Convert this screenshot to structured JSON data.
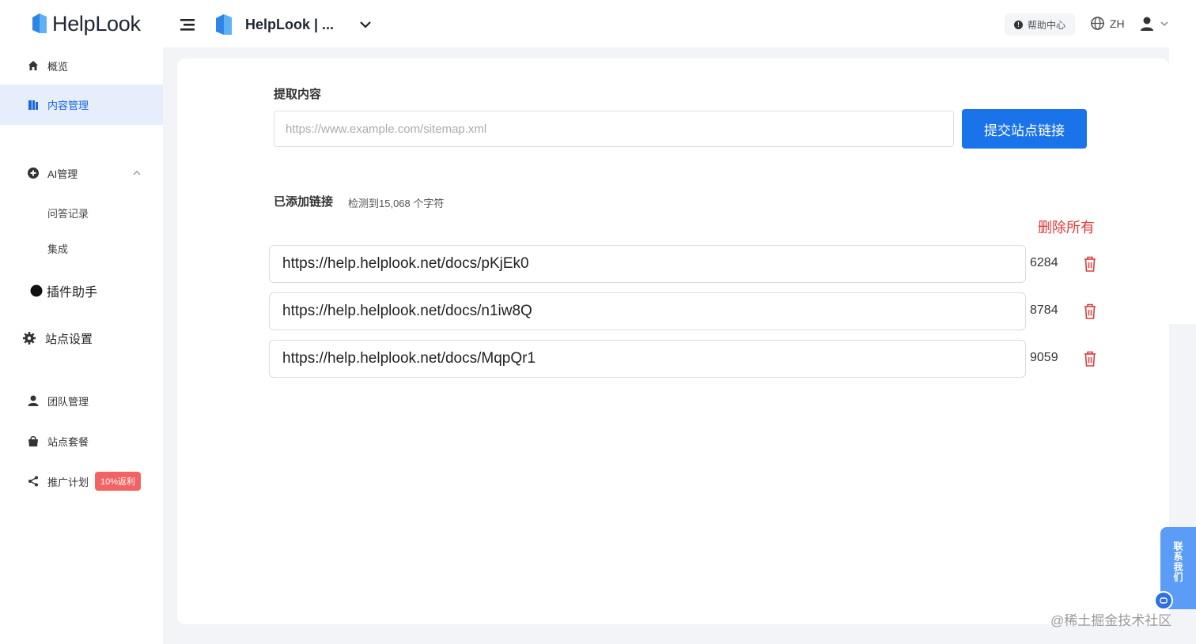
{
  "header": {
    "brand": "HelpLook",
    "site_name": "HelpLook | ...",
    "help_center": "帮助中心",
    "language": "ZH"
  },
  "sidebar": {
    "overview": "概览",
    "content_management": "内容管理",
    "ai_management": "AI管理",
    "qa_records": "问答记录",
    "integration": "集成",
    "plugin_assistant": "插件助手",
    "site_settings": "站点设置",
    "team_management": "团队管理",
    "site_plans": "站点套餐",
    "referral": "推广计划",
    "referral_badge": "10%返利"
  },
  "main": {
    "extract_title": "提取内容",
    "url_placeholder": "https://www.example.com/sitemap.xml",
    "submit_label": "提交站点链接",
    "added_title": "已添加链接",
    "detected_text": "检测到15,068 个字符",
    "delete_all": "删除所有",
    "links": [
      {
        "url": "https://help.helplook.net/docs/pKjEk0",
        "count": "6284"
      },
      {
        "url": "https://help.helplook.net/docs/n1iw8Q",
        "count": "8784"
      },
      {
        "url": "https://help.helplook.net/docs/MqpQr1",
        "count": "9059"
      }
    ]
  },
  "contact_tab": "联系我们",
  "watermark": "@稀土掘金技术社区",
  "colors": {
    "accent": "#1a73e8",
    "active_bg": "#e6eefb",
    "danger": "#e03b3b",
    "badge": "#f26363"
  }
}
